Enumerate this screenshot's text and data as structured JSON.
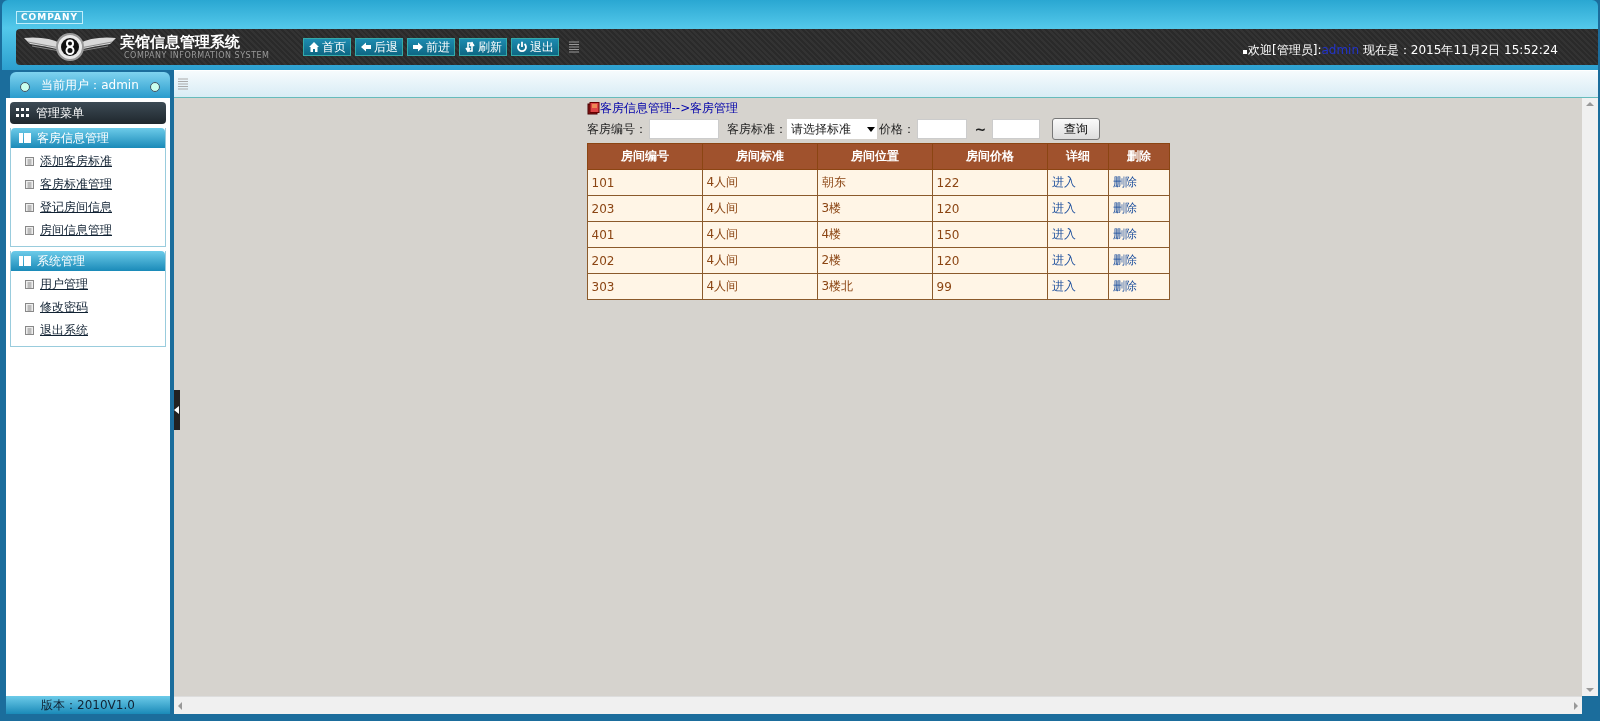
{
  "header": {
    "badge": "COMPANY",
    "title": "宾馆信息管理系统",
    "subtitle": "COMPANY INFORMATION SYSTEM",
    "nav": [
      {
        "kind": "home",
        "label": "首页"
      },
      {
        "kind": "back",
        "label": "后退"
      },
      {
        "kind": "forward",
        "label": "前进"
      },
      {
        "kind": "refresh",
        "label": "刷新"
      },
      {
        "kind": "power",
        "label": "退出"
      }
    ],
    "welcome": {
      "prefix": "欢迎[管理员]:",
      "user": "admin",
      "time": "现在是：2015年11月2日 15:52:24"
    }
  },
  "sidebar": {
    "current_user": "当前用户：admin",
    "menu_title": "管理菜单",
    "groups": [
      {
        "title": "客房信息管理",
        "items": [
          "添加客房标准",
          "客房标准管理",
          "登记房间信息",
          "房间信息管理"
        ]
      },
      {
        "title": "系统管理",
        "items": [
          "用户管理",
          "修改密码",
          "退出系统"
        ]
      }
    ],
    "version": "版本：2010V1.0"
  },
  "content": {
    "breadcrumb": "客房信息管理-->客房管理",
    "filters": {
      "room_no_label": "客房编号：",
      "standard_label": "客房标准：",
      "standard_value": "请选择标准",
      "price_label": "价格：",
      "range_sep": "~",
      "search_button": "查询"
    },
    "table": {
      "columns": [
        "房间编号",
        "房间标准",
        "房间位置",
        "房间价格",
        "详细",
        "删除"
      ],
      "rows": [
        [
          "101",
          "4人间",
          "朝东",
          "122",
          "进入",
          "删除"
        ],
        [
          "203",
          "4人间",
          "3楼",
          "120",
          "进入",
          "删除"
        ],
        [
          "401",
          "4人间",
          "4楼",
          "150",
          "进入",
          "删除"
        ],
        [
          "202",
          "4人间",
          "2楼",
          "120",
          "进入",
          "删除"
        ],
        [
          "303",
          "4人间",
          "3楼北",
          "99",
          "进入",
          "删除"
        ]
      ]
    }
  }
}
